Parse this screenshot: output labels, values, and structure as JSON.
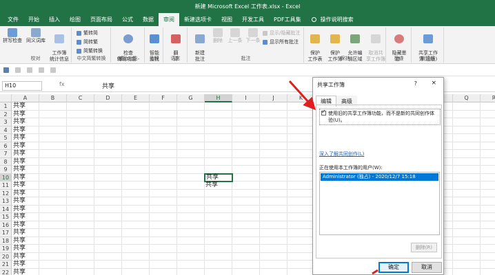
{
  "window": {
    "title": "新建 Microsoft Excel 工作表.xlsx - Excel"
  },
  "menu": {
    "tabs": [
      "文件",
      "开始",
      "插入",
      "绘图",
      "页面布局",
      "公式",
      "数据",
      "审阅",
      "新建选项卡",
      "视图",
      "开发工具",
      "PDF工具集"
    ],
    "active": "审阅",
    "search_label": "操作说明搜索"
  },
  "ribbon": {
    "groups": {
      "proofing": {
        "label": "校对",
        "spelling": "拼写检查",
        "thesaurus": "同义词库",
        "workbook_stats": "工作簿\n统计信息"
      },
      "chinese": {
        "label": "中文简繁转换",
        "to_simplified": "繁转简",
        "to_traditional": "简转繁",
        "convert": "简繁转换"
      },
      "accessibility": {
        "label": "辅助功能",
        "check": "检查\n辅助功能 -"
      },
      "insights": {
        "label": "见解",
        "smart_lookup": "智能\n查找"
      },
      "language": {
        "label": "语言",
        "translate": "翻\n译"
      },
      "comments": {
        "label": "批注",
        "new": "新建\n批注",
        "delete": "删除",
        "previous": "上一条",
        "next": "下一条",
        "show_hide": "显示/隐藏批注",
        "show_all": "显示所有批注"
      },
      "protect": {
        "label": "保护",
        "protect_sheet": "保护\n工作表",
        "protect_workbook": "保护\n工作簿",
        "allow_edit": "允许编\n辑区域",
        "unshare": "取消共\n享工作簿"
      },
      "ink": {
        "label": "墨迹",
        "hide_ink": "隐藏墨\n迹 -"
      },
      "new_group": {
        "label": "新建组",
        "share_workbook": "共享工作\n簿(旧版)"
      }
    }
  },
  "formula_bar": {
    "name_box": "H10",
    "fx": "fx",
    "content": "共享"
  },
  "grid": {
    "columns": [
      "A",
      "B",
      "C",
      "D",
      "E",
      "F",
      "G",
      "H",
      "I",
      "J",
      "K",
      "L",
      "M",
      "N",
      "O",
      "P",
      "Q",
      "R"
    ],
    "selected_column": "H",
    "rows": [
      "1",
      "2",
      "3",
      "4",
      "5",
      "6",
      "7",
      "8",
      "9",
      "10",
      "11",
      "12",
      "13",
      "14",
      "15",
      "16",
      "17",
      "18",
      "19",
      "20",
      "21",
      "22"
    ],
    "selected_row": "10",
    "col_a_values": [
      "共享",
      "共享",
      "共享",
      "共享",
      "共享",
      "共享",
      "共享",
      "共享",
      "共享",
      "共享",
      "共享",
      "共享",
      "共享",
      "共享",
      "共享",
      "共享",
      "共享",
      "共享",
      "共享",
      "共享",
      "共享",
      "共享"
    ],
    "h10_value": "共享",
    "h11_value": "共享"
  },
  "dialog": {
    "title": "共享工作簿",
    "help": "?",
    "close": "×",
    "tabs": [
      "编辑",
      "高级"
    ],
    "checkbox_label": "使用旧的共享工作簿功能，而不是新的共同创作体验(U)。",
    "checkbox_checked": true,
    "link": "深入了解共同创作(L)",
    "users_label": "正在使用本工作簿的用户(W):",
    "users": [
      "Administrator (独占) - 2020/12/7 15:18"
    ],
    "remove_button": "删除(R)",
    "ok_button": "确定",
    "cancel_button": "取消"
  },
  "colors": {
    "excel_green": "#217346",
    "annotation_red": "#e02020",
    "selection_blue": "#0078d7"
  }
}
